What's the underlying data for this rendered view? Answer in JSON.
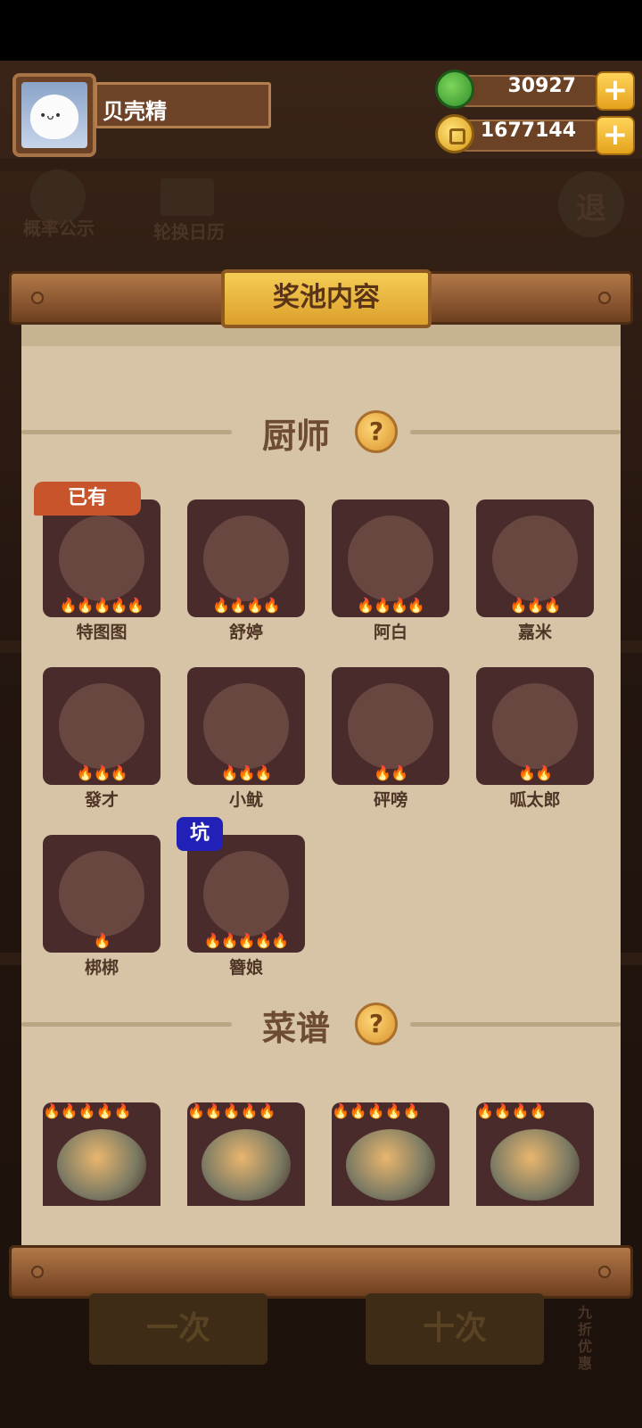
{
  "profile": {
    "name": "贝壳精"
  },
  "currency": {
    "jade": "30927",
    "coins": "1677144",
    "plus_label": "+"
  },
  "background": {
    "probability_label": "概率公示",
    "calendar_label": "轮换日历",
    "exit_label": "退",
    "draw_one_label": "一次",
    "draw_ten_label": "十次",
    "discount_label": "九折优惠"
  },
  "panel": {
    "title": "奖池内容",
    "chef_section": "厨师",
    "recipe_section": "菜谱",
    "help_glyph": "?",
    "owned_badge": "已有",
    "pit_badge": "坑"
  },
  "chefs": [
    {
      "name": "特图图",
      "stars": 5,
      "owned": true
    },
    {
      "name": "舒婷",
      "stars": 4
    },
    {
      "name": "阿白",
      "stars": 4
    },
    {
      "name": "嘉米",
      "stars": 3
    },
    {
      "name": "發才",
      "stars": 3
    },
    {
      "name": "小鱿",
      "stars": 3
    },
    {
      "name": "砰嗙",
      "stars": 2
    },
    {
      "name": "呱太郎",
      "stars": 2
    },
    {
      "name": "梆梆",
      "stars": 1
    },
    {
      "name": "簪娘",
      "stars": 5,
      "pit": true
    }
  ],
  "recipes": [
    {
      "stars": 5
    },
    {
      "stars": 5
    },
    {
      "stars": 5
    },
    {
      "stars": 4
    }
  ],
  "colors": {
    "accent_gold": "#f4cd55",
    "paper": "#d7c4a6",
    "card_bg": "#4a2b2b",
    "owned_badge": "#c8542c",
    "pit_badge": "#2121b8"
  }
}
